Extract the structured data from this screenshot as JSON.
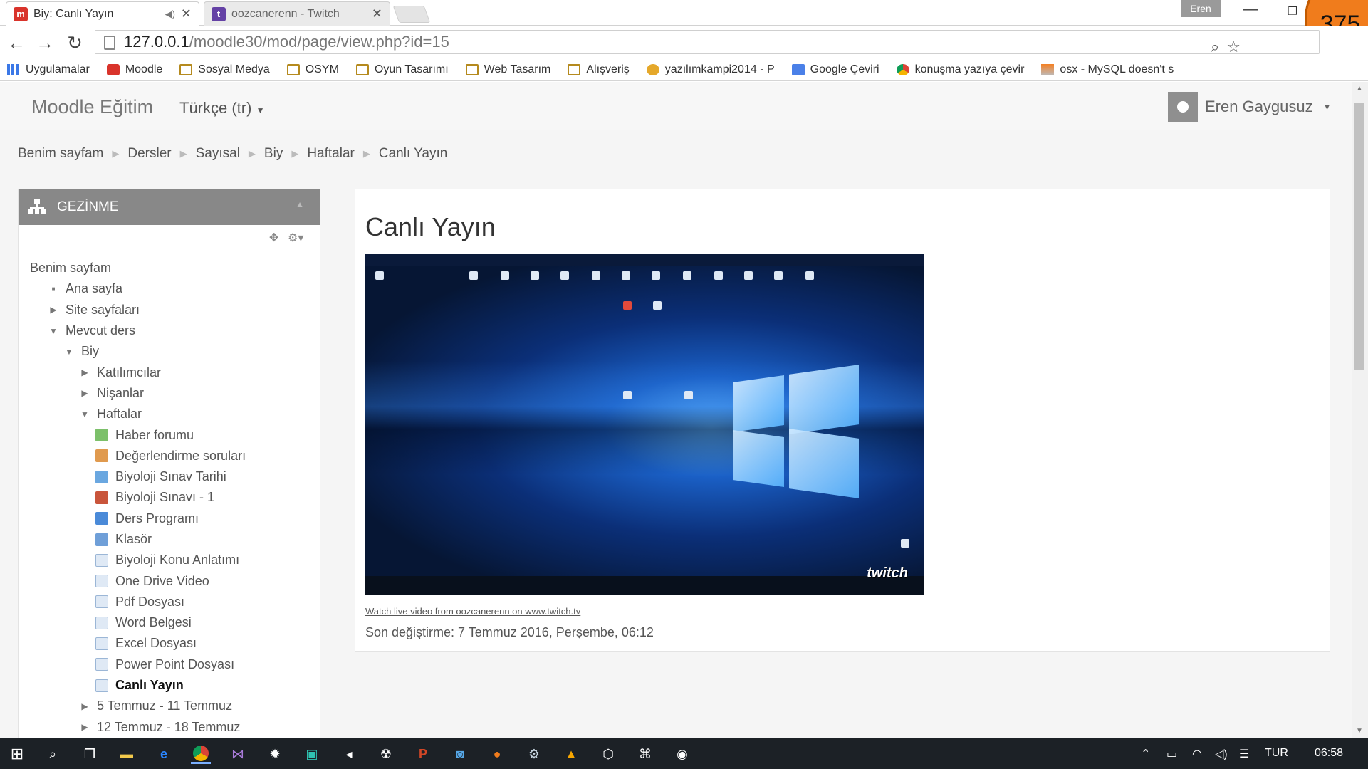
{
  "browser": {
    "tabs": [
      {
        "title": "Biy: Canlı Yayın",
        "favicon": "moodle-favicon",
        "active": true
      },
      {
        "title": "oozcanerenn - Twitch",
        "favicon": "twitch-favicon",
        "active": false
      }
    ],
    "profile_name": "Eren",
    "badge": "375",
    "url_host": "127.0.0.1",
    "url_path": "/moodle30/mod/page/view.php?id=15",
    "bookmarks": [
      {
        "label": "Uygulamalar",
        "icon": "apps-grid-icon"
      },
      {
        "label": "Moodle",
        "icon": "moodle-icon"
      },
      {
        "label": "Sosyal Medya",
        "icon": "folder-icon"
      },
      {
        "label": "OSYM",
        "icon": "folder-icon"
      },
      {
        "label": "Oyun Tasarımı",
        "icon": "folder-icon"
      },
      {
        "label": "Web Tasarım",
        "icon": "folder-icon"
      },
      {
        "label": "Alışveriş",
        "icon": "folder-icon"
      },
      {
        "label": "yazılımkampi2014 - P",
        "icon": "tiger-icon"
      },
      {
        "label": "Google Çeviri",
        "icon": "translate-icon"
      },
      {
        "label": "konuşma yazıya çevir",
        "icon": "chrome-icon"
      },
      {
        "label": "osx - MySQL doesn't s",
        "icon": "stackoverflow-icon"
      }
    ]
  },
  "navbar": {
    "brand": "Moodle Eğitim",
    "language": "Türkçe (tr)",
    "user": "Eren Gaygusuz"
  },
  "breadcrumb": [
    "Benim sayfam",
    "Dersler",
    "Sayısal",
    "Biy",
    "Haftalar",
    "Canlı Yayın"
  ],
  "navigation": {
    "header": "GEZİNME",
    "items": [
      {
        "label": "Benim sayfam",
        "level": 0,
        "mark": "none"
      },
      {
        "label": "Ana sayfa",
        "level": 1,
        "mark": "bullet"
      },
      {
        "label": "Site sayfaları",
        "level": 1,
        "mark": "collapsed"
      },
      {
        "label": "Mevcut ders",
        "level": 1,
        "mark": "expanded"
      },
      {
        "label": "Biy",
        "level": 2,
        "mark": "expanded"
      },
      {
        "label": "Katılımcılar",
        "level": 3,
        "mark": "collapsed"
      },
      {
        "label": "Nişanlar",
        "level": 3,
        "mark": "collapsed"
      },
      {
        "label": "Haftalar",
        "level": 3,
        "mark": "expanded"
      },
      {
        "label": "Haber forumu",
        "level": 4,
        "mark": "forum"
      },
      {
        "label": "Değerlendirme soruları",
        "level": 4,
        "mark": "feedback"
      },
      {
        "label": "Biyoloji Sınav Tarihi",
        "level": 4,
        "mark": "question"
      },
      {
        "label": "Biyoloji Sınavı - 1",
        "level": 4,
        "mark": "quiz"
      },
      {
        "label": "Ders Programı",
        "level": 4,
        "mark": "url"
      },
      {
        "label": "Klasör",
        "level": 4,
        "mark": "folder"
      },
      {
        "label": "Biyoloji Konu Anlatımı",
        "level": 4,
        "mark": "page"
      },
      {
        "label": "One Drive Video",
        "level": 4,
        "mark": "page"
      },
      {
        "label": "Pdf Dosyası",
        "level": 4,
        "mark": "page"
      },
      {
        "label": "Word Belgesi",
        "level": 4,
        "mark": "page"
      },
      {
        "label": "Excel Dosyası",
        "level": 4,
        "mark": "page"
      },
      {
        "label": "Power Point Dosyası",
        "level": 4,
        "mark": "page"
      },
      {
        "label": "Canlı Yayın",
        "level": 4,
        "mark": "page",
        "current": true
      },
      {
        "label": "5 Temmuz - 11 Temmuz",
        "level": 3,
        "mark": "collapsed"
      },
      {
        "label": "12 Temmuz - 18 Temmuz",
        "level": 3,
        "mark": "collapsed"
      }
    ]
  },
  "main": {
    "title": "Canlı Yayın",
    "video_watermark": "twitch",
    "watch_link": "Watch live video from oozcanerenn on www.twitch.tv",
    "last_modified": "Son değiştirme: 7 Temmuz 2016, Perşembe, 06:12"
  },
  "taskbar": {
    "language": "TUR",
    "clock": "06:58"
  }
}
